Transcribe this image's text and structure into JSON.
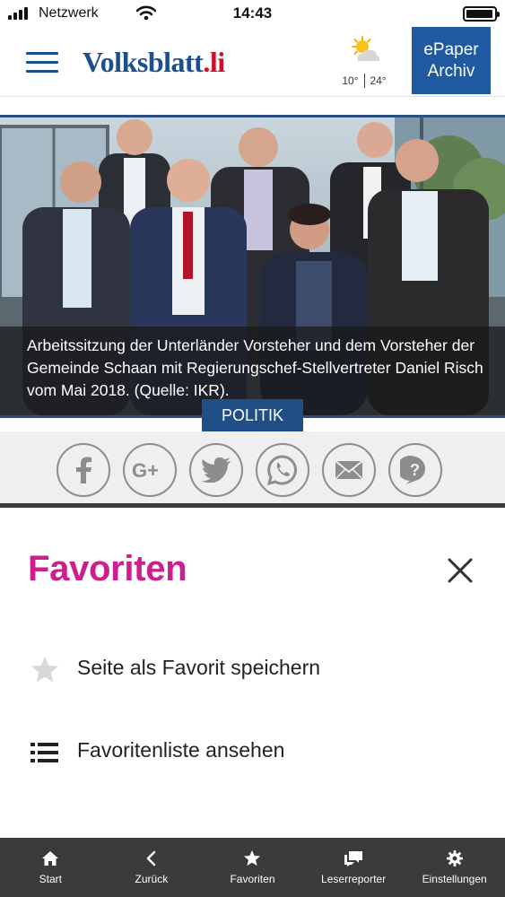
{
  "status_bar": {
    "carrier": "Netzwerk",
    "time": "14:43",
    "battery_level": 0.95
  },
  "header": {
    "logo_part1": "Volksblatt",
    "logo_part2": ".li",
    "weather": {
      "icon": "partly-cloudy-icon",
      "temp_low": "10°",
      "temp_high": "24°"
    },
    "epaper_line1": "ePaper",
    "epaper_line2": "Archiv"
  },
  "article": {
    "caption": "Arbeitssitzung der Unterländer Vorsteher und dem Vorsteher der Gemeinde Schaan mit Regierungschef-Stellvertreter Daniel Risch vom Mai 2018. (Quelle: IKR).",
    "category": "POLITIK"
  },
  "share_buttons": [
    {
      "icon": "facebook-icon"
    },
    {
      "icon": "google-plus-icon"
    },
    {
      "icon": "twitter-icon"
    },
    {
      "icon": "whatsapp-icon"
    },
    {
      "icon": "email-icon"
    },
    {
      "icon": "help-icon"
    }
  ],
  "favorites": {
    "title": "Favoriten",
    "items": [
      {
        "icon": "star-icon",
        "label": "Seite als Favorit speichern"
      },
      {
        "icon": "list-icon",
        "label": "Favoritenliste ansehen"
      }
    ]
  },
  "bottom_nav": [
    {
      "icon": "home-icon",
      "label": "Start"
    },
    {
      "icon": "chevron-left-icon",
      "label": "Zurück"
    },
    {
      "icon": "star-icon",
      "label": "Favoriten"
    },
    {
      "icon": "chat-icon",
      "label": "Leserreporter"
    },
    {
      "icon": "gear-icon",
      "label": "Einstellungen"
    }
  ],
  "colors": {
    "brand_blue": "#1b4f8f",
    "brand_red": "#d0102a",
    "accent_magenta": "#cc1e8c",
    "nav_background": "#3b3b3b"
  }
}
